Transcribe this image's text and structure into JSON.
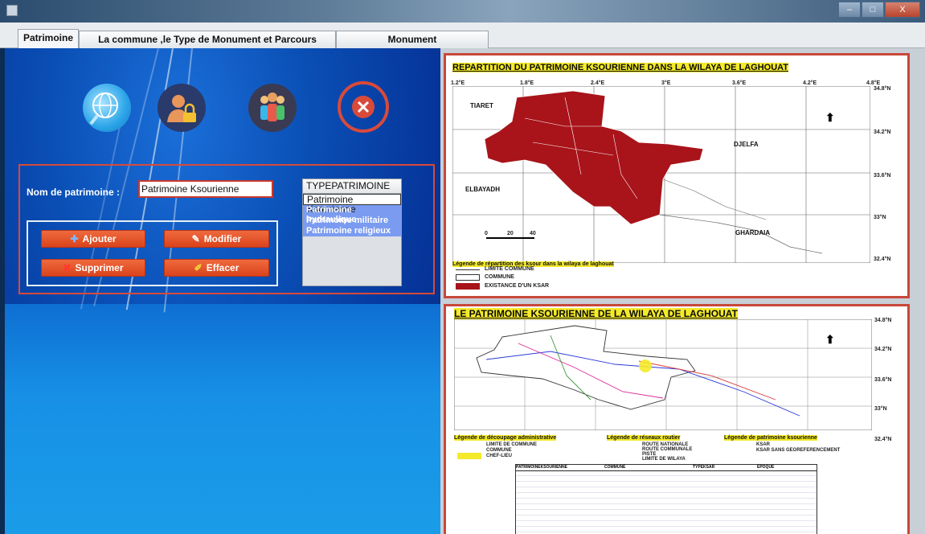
{
  "window": {
    "minimize": "–",
    "maximize": "□",
    "close": "X"
  },
  "tabs": [
    {
      "label": "Patrimoine",
      "active": true
    },
    {
      "label": "La commune ,le  Type de Monument et Parcours Touristique",
      "active": false
    },
    {
      "label": "Monument",
      "active": false
    }
  ],
  "toolbar_icons": [
    {
      "name": "globe-search-icon",
      "color": "#2aa4e8"
    },
    {
      "name": "user-lock-icon",
      "color": "#2a3a6a"
    },
    {
      "name": "group-users-icon",
      "color": "#3a3a52"
    },
    {
      "name": "close-icon",
      "color": "#d94a3a"
    }
  ],
  "form": {
    "nom_label": "Nom de patrimoine  :",
    "nom_value": "Patrimoine Ksourienne"
  },
  "buttons": {
    "ajouter": "Ajouter",
    "modifier": "Modifier",
    "supprimer": "Supprimer",
    "effacer": "Effacer"
  },
  "type_list": {
    "header": "TYPEPATRIMOINE",
    "items": [
      "Patrimoine Ksourienne",
      "Patrimoine hydraulique",
      "Patrimoine militaire",
      "Patrimoine religieux"
    ],
    "selected": 0
  },
  "map1": {
    "title": "REPARTITION DU PATRIMOINE KSOURIENNE DANS LA WILAYA DE LAGHOUAT",
    "top_coords": [
      "1.2°E",
      "1.8°E",
      "2.4°E",
      "3°E",
      "3.6°E",
      "4.2°E",
      "4.8°E"
    ],
    "right_coords": [
      "34.8°N",
      "34.2°N",
      "33.6°N",
      "33°N",
      "32.4°N"
    ],
    "regions": [
      "TIARET",
      "DJELFA",
      "ELBAYADH",
      "GHARDAIA"
    ],
    "scale": [
      "0",
      "20",
      "40"
    ],
    "legend_title": "Légende de répartition des ksour dans la wilaya de laghouat",
    "legend_items": [
      "LIMITE COMMUNE",
      "COMMUNE",
      "EXISTANCE D'UN KSAR"
    ],
    "colors": {
      "ksar": "#a8141a"
    }
  },
  "map2": {
    "title": "LE PATRIMOINE KSOURIENNE DE LA WILAYA DE LAGHOUAT",
    "right_coords": [
      "34.8°N",
      "34.2°N",
      "33.6°N",
      "33°N",
      "32.4°N"
    ],
    "legend_titles": [
      "Légende de découpage administrative",
      "Légende de réseaux routier",
      "Légende de patrimoine ksourienne"
    ],
    "legend_left": [
      "LIMITE DE COMMUNE",
      "COMMUNE",
      "CHEF-LIEU"
    ],
    "legend_mid": [
      "ROUTE NATIONALE",
      "ROUTE COMMUNALE",
      "PISTE",
      "LIMITE DE WILAYA"
    ],
    "legend_right": [
      "KSAR",
      "KSAR SANS GEOREFERENCEMENT"
    ],
    "table_headers": [
      "PATRIMOINEKSOURIENNE",
      "COMMUNE",
      "TYPEKSAR",
      "EPOQUE"
    ]
  }
}
